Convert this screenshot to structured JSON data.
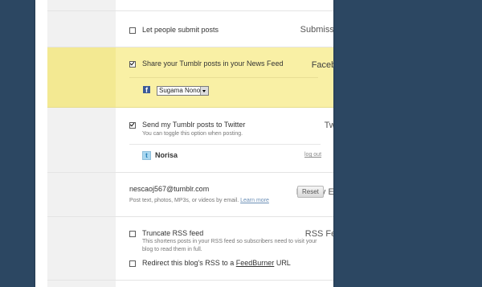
{
  "submissions": {
    "label": "Submissions",
    "option": "Let people submit posts",
    "checked": false
  },
  "facebook": {
    "label": "Facebook",
    "option": "Share your Tumblr posts in your News Feed",
    "checked": true,
    "account": "Sugama Nono"
  },
  "twitter": {
    "label": "Twitter",
    "option": "Send my Tumblr posts to Twitter",
    "checked": true,
    "hint": "You can toggle this option when posting.",
    "account": "Norisa",
    "logout": "log out"
  },
  "post_by_email": {
    "label": "Post by Email",
    "address": "nescaoj567@tumblr.com",
    "hint": "Post text, photos, MP3s, or videos by email.",
    "learn_more": "Learn more",
    "reset_button": "Reset"
  },
  "rss": {
    "label": "RSS Feeds",
    "truncate": {
      "option": "Truncate RSS feed",
      "checked": false,
      "hint_line1": "This shortens posts in your RSS feed so subscribers need to visit your",
      "hint_line2": "blog to read them in full."
    },
    "redirect": {
      "option_prefix": "Redirect this blog's RSS to a ",
      "option_link": "FeedBurner",
      "option_suffix": " URL",
      "checked": false
    }
  }
}
